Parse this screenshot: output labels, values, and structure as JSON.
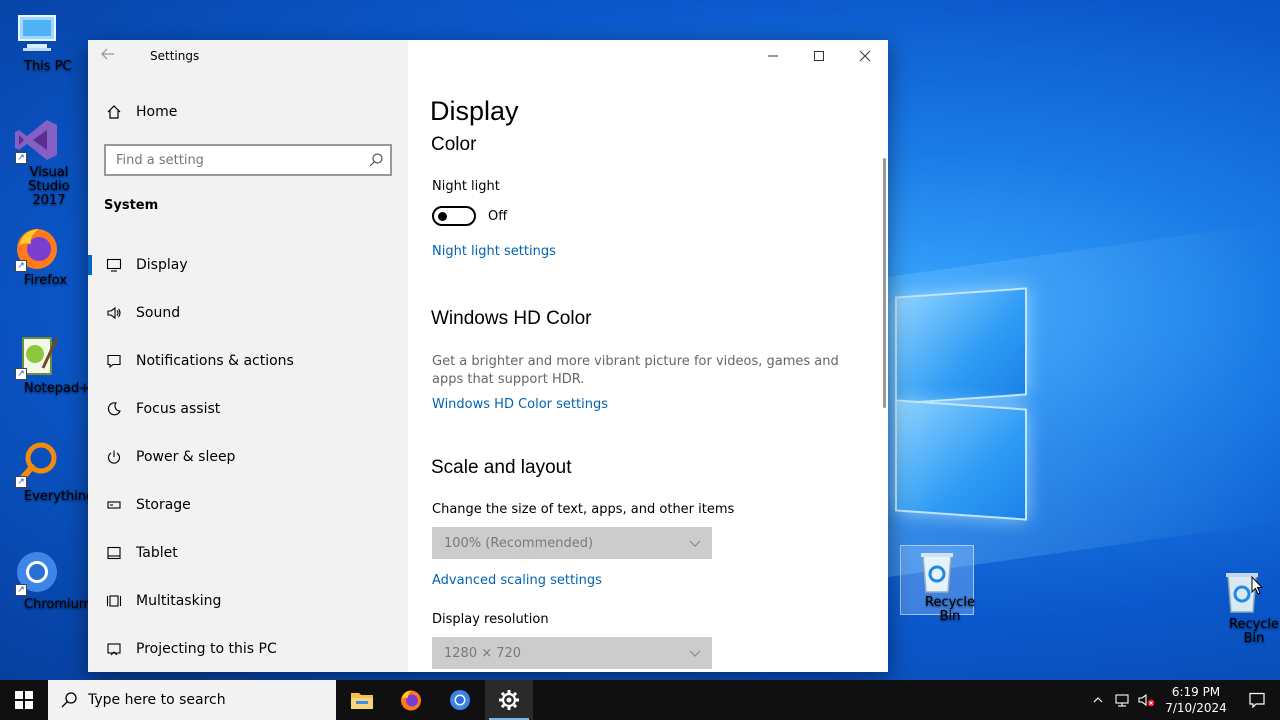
{
  "desktop": {
    "icons": [
      {
        "label": "This PC"
      },
      {
        "label": "Visual Studio 2017"
      },
      {
        "label": "Firefox"
      },
      {
        "label": "Notepad++"
      },
      {
        "label": "Everything"
      },
      {
        "label": "Chromium"
      },
      {
        "label": "Recycle Bin"
      },
      {
        "label": "Recycle Bin"
      }
    ]
  },
  "window": {
    "title": "Settings",
    "controls": {
      "minimize": "–",
      "maximize": "☐",
      "close": "✕"
    }
  },
  "sidebar": {
    "home_label": "Home",
    "search_placeholder": "Find a setting",
    "section": "System",
    "items": [
      {
        "label": "Display"
      },
      {
        "label": "Sound"
      },
      {
        "label": "Notifications & actions"
      },
      {
        "label": "Focus assist"
      },
      {
        "label": "Power & sleep"
      },
      {
        "label": "Storage"
      },
      {
        "label": "Tablet"
      },
      {
        "label": "Multitasking"
      },
      {
        "label": "Projecting to this PC"
      }
    ]
  },
  "content": {
    "page_title": "Display",
    "color": {
      "heading": "Color",
      "night_light_label": "Night light",
      "night_light_state": "Off",
      "night_light_link": "Night light settings"
    },
    "hdr": {
      "heading": "Windows HD Color",
      "description": "Get a brighter and more vibrant picture for videos, games and apps that support HDR.",
      "link": "Windows HD Color settings"
    },
    "scale": {
      "heading": "Scale and layout",
      "size_label": "Change the size of text, apps, and other items",
      "size_value": "100% (Recommended)",
      "advanced_link": "Advanced scaling settings",
      "resolution_label": "Display resolution",
      "resolution_value": "1280 × 720"
    }
  },
  "taskbar": {
    "search_placeholder": "Type here to search",
    "time": "6:19 PM",
    "date": "7/10/2024"
  },
  "colors": {
    "accent": "#0067c0",
    "link": "#0063b1",
    "sidebar_bg": "#f2f2f2",
    "taskbar_bg": "#101010"
  }
}
